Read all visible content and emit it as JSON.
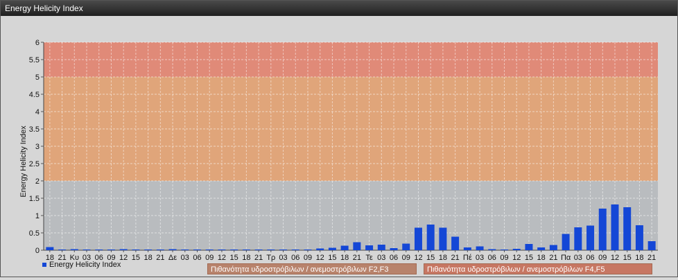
{
  "window": {
    "title": "Energy Helicity Index"
  },
  "legend": {
    "series_label": "Energy Helicity Index",
    "risk_f23": "Πιθανότητα υδροστρόβιλων / ανεμοστρόβιλων F2,F3",
    "risk_f45": "Πιθανότητα υδροστρόβιλων / ανεμοστρόβιλων F4,F5"
  },
  "colors": {
    "bar": "#1447d6",
    "band_low": "#b9bcbf",
    "band_mid": "#e0a57a",
    "band_high": "#e08a78"
  },
  "chart_data": {
    "type": "bar",
    "ylabel": "Energy Helicity Index",
    "ylim": [
      0,
      6
    ],
    "yticks": [
      "0",
      "0.5",
      "1",
      "1.5",
      "2",
      "2.5",
      "3",
      "3.5",
      "4",
      "4.5",
      "5",
      "5.5",
      "6"
    ],
    "bands": [
      {
        "from": 0,
        "to": 2,
        "color": "#b9bcbf"
      },
      {
        "from": 2,
        "to": 5,
        "color": "#e0a57a"
      },
      {
        "from": 5,
        "to": 6,
        "color": "#e08a78"
      }
    ],
    "grid": true,
    "legend_position": "bottom-left",
    "categories": [
      "18",
      "21",
      "Κυ",
      "03",
      "06",
      "09",
      "12",
      "15",
      "18",
      "21",
      "Δε",
      "03",
      "06",
      "09",
      "12",
      "15",
      "18",
      "21",
      "Τρ",
      "03",
      "06",
      "09",
      "12",
      "15",
      "18",
      "21",
      "Τε",
      "03",
      "06",
      "09",
      "12",
      "15",
      "18",
      "21",
      "Πέ",
      "03",
      "06",
      "09",
      "12",
      "15",
      "18",
      "21",
      "Πα",
      "03",
      "06",
      "09",
      "12",
      "15",
      "18",
      "21"
    ],
    "series": [
      {
        "name": "Energy Helicity Index",
        "values": [
          0.09,
          0.02,
          0.03,
          0.02,
          0.02,
          0.02,
          0.03,
          0.02,
          0.02,
          0.02,
          0.03,
          0.02,
          0.02,
          0.02,
          0.02,
          0.02,
          0.02,
          0.02,
          0.02,
          0.02,
          0.02,
          0.02,
          0.05,
          0.07,
          0.13,
          0.23,
          0.14,
          0.16,
          0.06,
          0.19,
          0.65,
          0.74,
          0.65,
          0.39,
          0.08,
          0.11,
          0.03,
          0.02,
          0.04,
          0.18,
          0.08,
          0.15,
          0.47,
          0.66,
          0.71,
          1.2,
          1.32,
          1.24,
          0.72,
          0.26
        ]
      }
    ]
  }
}
